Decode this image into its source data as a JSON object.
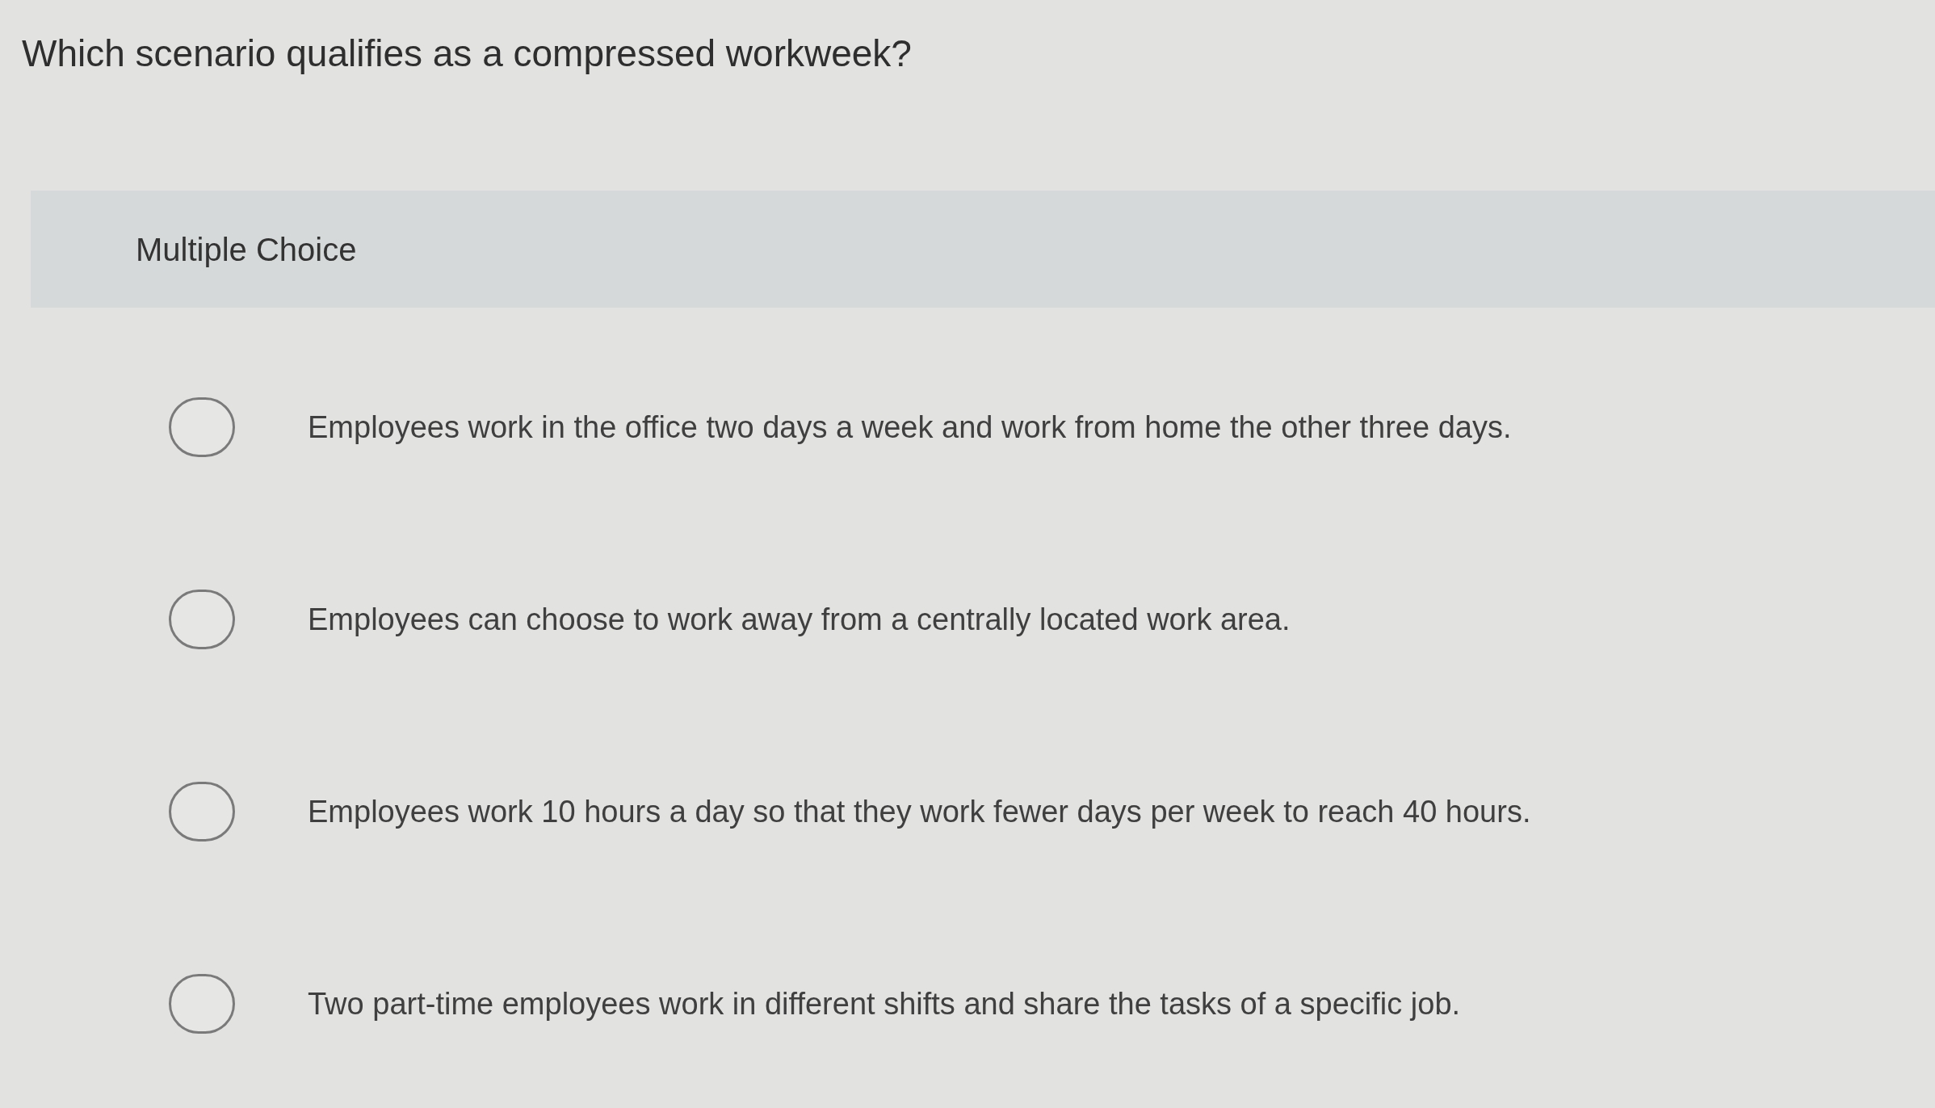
{
  "question": "Which scenario qualifies as a compressed workweek?",
  "section": {
    "label": "Multiple Choice"
  },
  "options": [
    {
      "text": "Employees work in the office two days a week and work from home the other three days.",
      "selected": false
    },
    {
      "text": "Employees can choose to work away from a centrally located work area.",
      "selected": false
    },
    {
      "text": "Employees work 10 hours a day so that they work fewer days per week to reach 40 hours.",
      "selected": false
    },
    {
      "text": "Two part-time employees work in different shifts and share the tasks of a specific job.",
      "selected": false
    }
  ]
}
